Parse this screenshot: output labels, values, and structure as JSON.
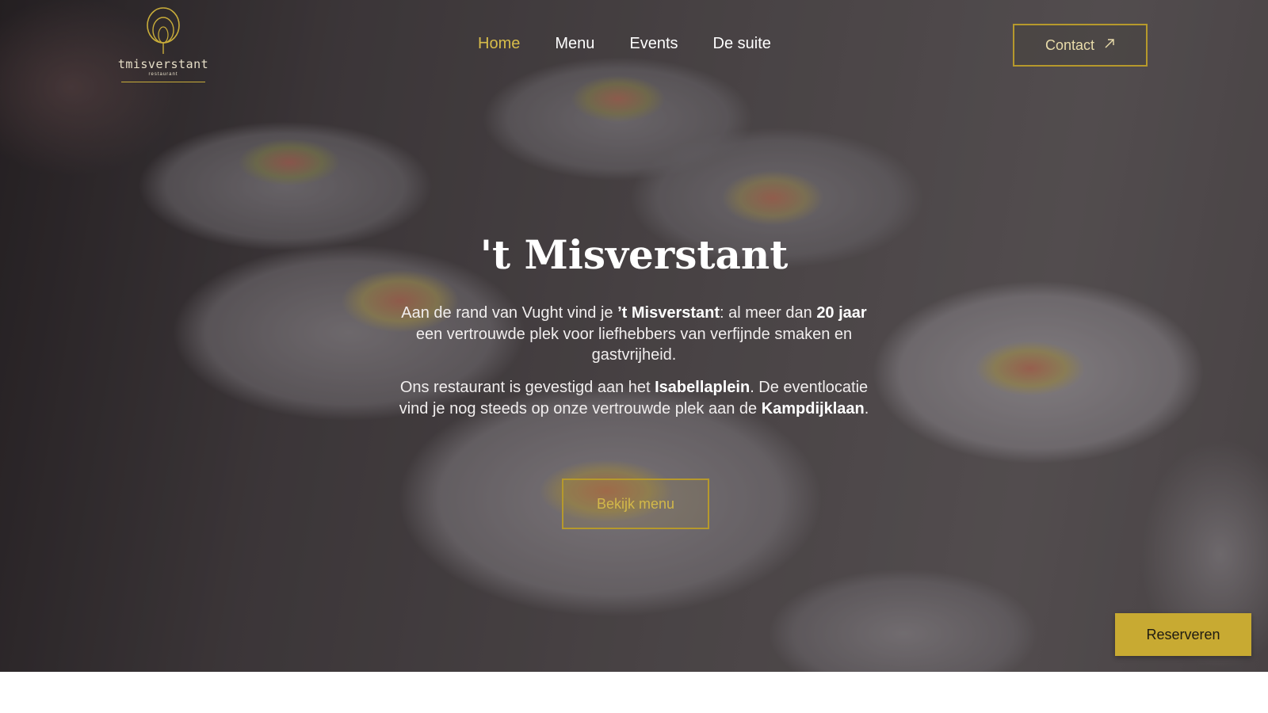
{
  "brand": {
    "logo_name": "tmisverstant",
    "logo_sub": "restaurant",
    "accent_color": "#c8aa32"
  },
  "nav": {
    "items": [
      {
        "label": "Home",
        "active": true
      },
      {
        "label": "Menu",
        "active": false
      },
      {
        "label": "Events",
        "active": false
      },
      {
        "label": "De suite",
        "active": false
      }
    ]
  },
  "contact_button": {
    "label": "Contact",
    "icon": "arrow-up-right-icon"
  },
  "hero": {
    "title": "'t Misverstant",
    "p1": {
      "t1": "Aan de rand van Vught vind je ",
      "b1": "’t Misverstant",
      "t2": ": al meer dan ",
      "b2": "20 jaar",
      "t3": " een vertrouwde plek voor liefhebbers van verfijnde smaken en gastvrijheid."
    },
    "p2": {
      "t1": "Ons restaurant is gevestigd aan het ",
      "b1": "Isabellaplein",
      "t2": ". De eventlocatie vind je nog steeds op onze vertrouwde plek aan de ",
      "b2": "Kampdijklaan",
      "t3": "."
    },
    "menu_button": "Bekijk menu"
  },
  "reserve_button": "Reserveren"
}
